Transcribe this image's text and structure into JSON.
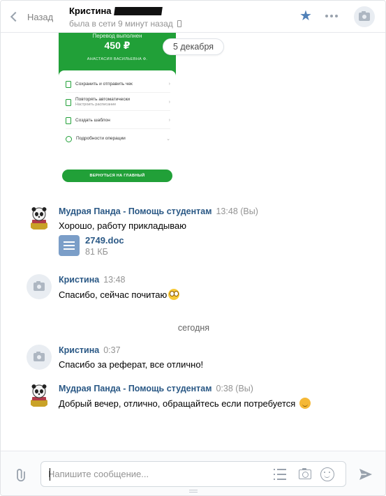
{
  "header": {
    "back_label": "Назад",
    "peer_name": "Кристина",
    "peer_status": "была в сети 9 минут назад"
  },
  "receipt": {
    "title": "Перевод выполнен",
    "amount": "450 ₽",
    "recipient": "АНАСТАСИЯ ВАСИЛЬЕВНА Ф.",
    "rows": [
      {
        "label": "Сохранить и отправить чек",
        "sub": ""
      },
      {
        "label": "Повторять автоматически",
        "sub": "Настроить расписание"
      },
      {
        "label": "Создать шаблон",
        "sub": ""
      },
      {
        "label": "Подробности операции",
        "sub": ""
      }
    ],
    "button": "ВЕРНУТЬСЯ НА ГЛАВНЫЙ"
  },
  "date_pill": "5 декабря",
  "day_separator": "сегодня",
  "messages": [
    {
      "author": "Мудрая Панда - Помощь студентам",
      "time": "13:48 (Вы)",
      "text": "Хорошо, работу прикладываю",
      "attachment": {
        "name": "2749.doc",
        "size": "81 КБ"
      }
    },
    {
      "author": "Кристина",
      "time": "13:48",
      "text": "Спасибо, сейчас почитаю"
    },
    {
      "author": "Кристина",
      "time": "0:37",
      "text": "Спасибо за реферат, все отлично!"
    },
    {
      "author": "Мудрая Панда - Помощь студентам",
      "time": "0:38 (Вы)",
      "text": "Добрый вечер, отлично, обращайтесь если потребуется"
    }
  ],
  "composer": {
    "placeholder": "Напишите сообщение...",
    "value": ""
  },
  "icons": [
    "back-chevron-icon",
    "phone-icon",
    "star-icon",
    "more-icon",
    "camera-icon",
    "doc-icon",
    "attach-icon",
    "list-icon",
    "smile-icon",
    "send-icon"
  ],
  "colors": {
    "accent": "#5181b8",
    "link": "#2a5885",
    "receipt_green": "#21a038",
    "muted": "#939393"
  }
}
